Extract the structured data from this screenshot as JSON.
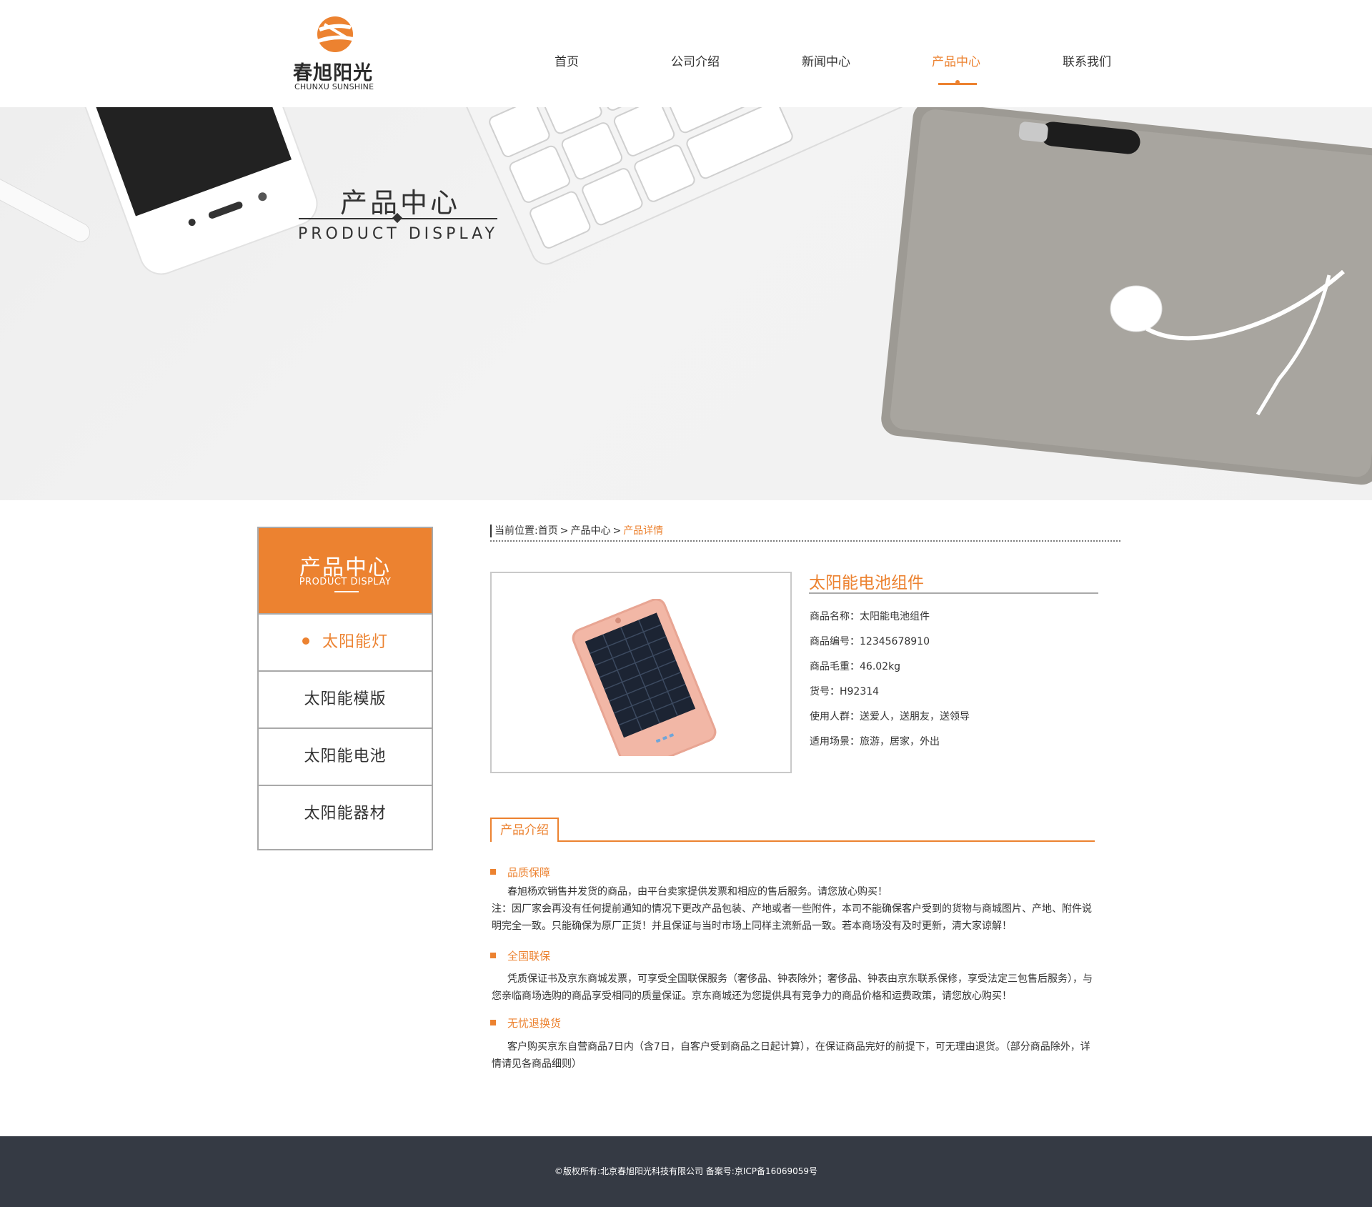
{
  "brand": {
    "name_cn": "春旭阳光",
    "name_en": "CHUNXU SUNSHINE",
    "colors": {
      "accent": "#ec8230",
      "footer": "#353a44",
      "text": "#333333"
    }
  },
  "nav": {
    "items": [
      {
        "label": "首页"
      },
      {
        "label": "公司介绍"
      },
      {
        "label": "新闻中心"
      },
      {
        "label": "产品中心",
        "active": true
      },
      {
        "label": "联系我们"
      }
    ]
  },
  "banner": {
    "title_cn": "产品中心",
    "title_en": "PRODUCT DISPLAY"
  },
  "sidebar": {
    "title_cn": "产品中心",
    "title_en": "PRODUCT DISPLAY",
    "items": [
      {
        "label": "太阳能灯",
        "active": true
      },
      {
        "label": "太阳能模版"
      },
      {
        "label": "太阳能电池"
      },
      {
        "label": "太阳能器材"
      }
    ]
  },
  "breadcrumb": {
    "prefix": "当前位置:",
    "items": [
      "首页",
      "产品中心"
    ],
    "separator": ">",
    "current": "产品详情"
  },
  "product": {
    "title": "太阳能电池组件",
    "specs": [
      "商品名称：太阳能电池组件",
      "商品编号：12345678910",
      "商品毛重：46.02kg",
      "货号：H92314",
      "使用人群：送爱人，送朋友，送领导",
      "适用场景：旅游，居家，外出"
    ]
  },
  "intro": {
    "tab_label": "产品介绍",
    "sections": [
      {
        "heading": "品质保障",
        "paragraphs": [
          "春旭杨欢销售并发货的商品，由平台卖家提供发票和相应的售后服务。请您放心购买！",
          "注：因厂家会再没有任何提前通知的情况下更改产品包装、产地或者一些附件，本司不能确保客户受到的货物与商城图片、产地、附件说明完全一致。只能确保为原厂正货！并且保证与当时市场上同样主流新品一致。若本商场没有及时更新，清大家谅解！"
        ]
      },
      {
        "heading": "全国联保",
        "paragraphs": [
          "凭质保证书及京东商城发票，可享受全国联保服务（奢侈品、钟表除外；奢侈品、钟表由京东联系保修，享受法定三包售后服务），与您亲临商场选购的商品享受相同的质量保证。京东商城还为您提供具有竞争力的商品价格和运费政策，请您放心购买！"
        ]
      },
      {
        "heading": "无忧退换货",
        "paragraphs": [
          "客户购买京东自营商品7日内（含7日，自客户受到商品之日起计算），在保证商品完好的前提下，可无理由退货。（部分商品除外，详情请见各商品细则）"
        ]
      }
    ]
  },
  "footer": {
    "text": "©版权所有:北京春旭阳光科技有限公司   备案号:京ICP备16069059号"
  },
  "icons": [
    "logo-mark-icon",
    "dot-icon",
    "square-bullet-icon"
  ]
}
